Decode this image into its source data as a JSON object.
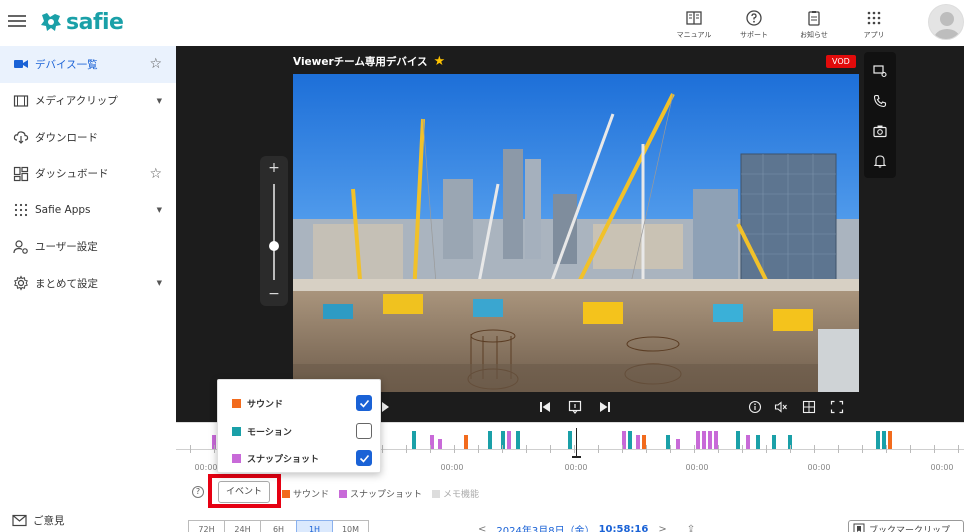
{
  "brand": {
    "name": "safie",
    "color": "#1aa0a8"
  },
  "header": {
    "actions": [
      {
        "id": "manual",
        "label": "マニュアル",
        "icon": "book-icon"
      },
      {
        "id": "support",
        "label": "サポート",
        "icon": "help-circle-icon"
      },
      {
        "id": "notice",
        "label": "お知らせ",
        "icon": "clipboard-icon"
      },
      {
        "id": "apps",
        "label": "アプリ",
        "icon": "grid-dots-icon"
      }
    ]
  },
  "sidebar": {
    "items": [
      {
        "id": "device-list",
        "label": "デバイス一覧",
        "icon": "video-camera-icon",
        "trail": "star",
        "active": true
      },
      {
        "id": "media-clip",
        "label": "メディアクリップ",
        "icon": "film-icon",
        "trail": "caret"
      },
      {
        "id": "download",
        "label": "ダウンロード",
        "icon": "cloud-download-icon",
        "trail": ""
      },
      {
        "id": "dashboard",
        "label": "ダッシュボード",
        "icon": "dashboard-icon",
        "trail": "star"
      },
      {
        "id": "safie-apps",
        "label": "Safie Apps",
        "icon": "dots-grid-icon",
        "trail": "caret"
      },
      {
        "id": "user-settings",
        "label": "ユーザー設定",
        "icon": "user-gear-icon",
        "trail": ""
      },
      {
        "id": "bulk-settings",
        "label": "まとめて設定",
        "icon": "gear-icon",
        "trail": "caret"
      }
    ],
    "feedback_label": "ご意見"
  },
  "player": {
    "device_title": "Viewerチーム専用デバイス",
    "vod_badge": "VOD",
    "zoom_level": 0.35
  },
  "timeline": {
    "tick_labels": [
      "00:00",
      "00:00",
      "00:00",
      "00:00",
      "00:00",
      "00:00"
    ]
  },
  "event_bar": {
    "button_label": "イベント",
    "legend": [
      {
        "label": "サウンド",
        "color": "#f26b1d",
        "muted": false
      },
      {
        "label": "スナップショット",
        "color": "#c86ad8",
        "muted": false
      },
      {
        "label": "メモ機能",
        "color": "#dddddd",
        "muted": true
      }
    ]
  },
  "event_popup": {
    "rows": [
      {
        "label": "サウンド",
        "color": "#f26b1d",
        "checked": true
      },
      {
        "label": "モーション",
        "color": "#1aa0a8",
        "checked": false
      },
      {
        "label": "スナップショット",
        "color": "#c86ad8",
        "checked": true
      }
    ]
  },
  "range_buttons": [
    {
      "label": "72H",
      "active": false
    },
    {
      "label": "24H",
      "active": false
    },
    {
      "label": "6H",
      "active": false
    },
    {
      "label": "1H",
      "active": true
    },
    {
      "label": "10M",
      "active": false
    }
  ],
  "date_nav": {
    "prev": "<",
    "date": "2024年3月8日（金）",
    "time": "10:58:16",
    "next": ">"
  },
  "bookmark": {
    "label": "ブックマークリップ"
  },
  "colors": {
    "accent": "#1a62d6",
    "highlight": "#e60012"
  }
}
